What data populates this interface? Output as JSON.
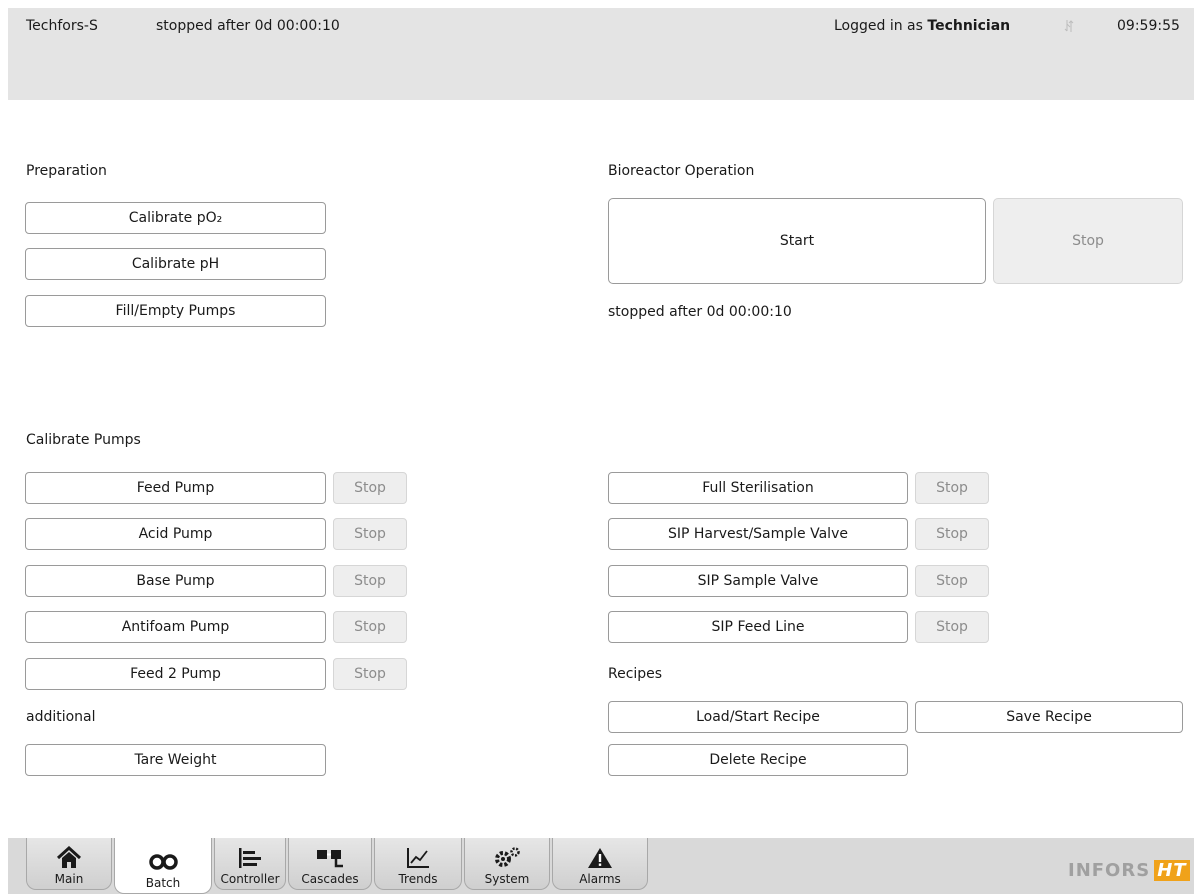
{
  "header": {
    "device": "Techfors-S",
    "status": "stopped after 0d 00:00:10",
    "login_prefix": "Logged in as",
    "login_user": "Technician",
    "time": "09:59:55"
  },
  "preparation": {
    "label": "Preparation",
    "buttons": [
      "Calibrate pO₂",
      "Calibrate pH",
      "Fill/Empty Pumps"
    ]
  },
  "bioreactor": {
    "label": "Bioreactor Operation",
    "start": "Start",
    "stop": "Stop",
    "status": "stopped after 0d 00:00:10"
  },
  "calibrate_pumps": {
    "label": "Calibrate Pumps",
    "stop_label": "Stop",
    "pumps": [
      "Feed Pump",
      "Acid Pump",
      "Base Pump",
      "Antifoam Pump",
      "Feed 2 Pump"
    ]
  },
  "sterilisation": {
    "stop_label": "Stop",
    "items": [
      "Full Sterilisation",
      "SIP Harvest/Sample Valve",
      "SIP Sample Valve",
      "SIP Feed Line"
    ]
  },
  "additional": {
    "label": "additional",
    "tare": "Tare Weight"
  },
  "recipes": {
    "label": "Recipes",
    "load": "Load/Start Recipe",
    "save": "Save Recipe",
    "delete": "Delete Recipe"
  },
  "tabs": [
    {
      "label": "Main",
      "icon": "home-icon"
    },
    {
      "label": "Batch",
      "icon": "batch-icon",
      "active": true
    },
    {
      "label": "Controller",
      "icon": "controller-icon"
    },
    {
      "label": "Cascades",
      "icon": "cascades-icon"
    },
    {
      "label": "Trends",
      "icon": "trends-icon"
    },
    {
      "label": "System",
      "icon": "gears-icon"
    },
    {
      "label": "Alarms",
      "icon": "warning-icon"
    }
  ],
  "logo": {
    "word": "INFORS",
    "mark": "HT"
  },
  "colors": {
    "header_bg": "#e4e4e4",
    "tabbar_bg": "#d9d9d9",
    "logo_accent": "#f0a21a",
    "disabled_text": "#8c8c8c"
  }
}
